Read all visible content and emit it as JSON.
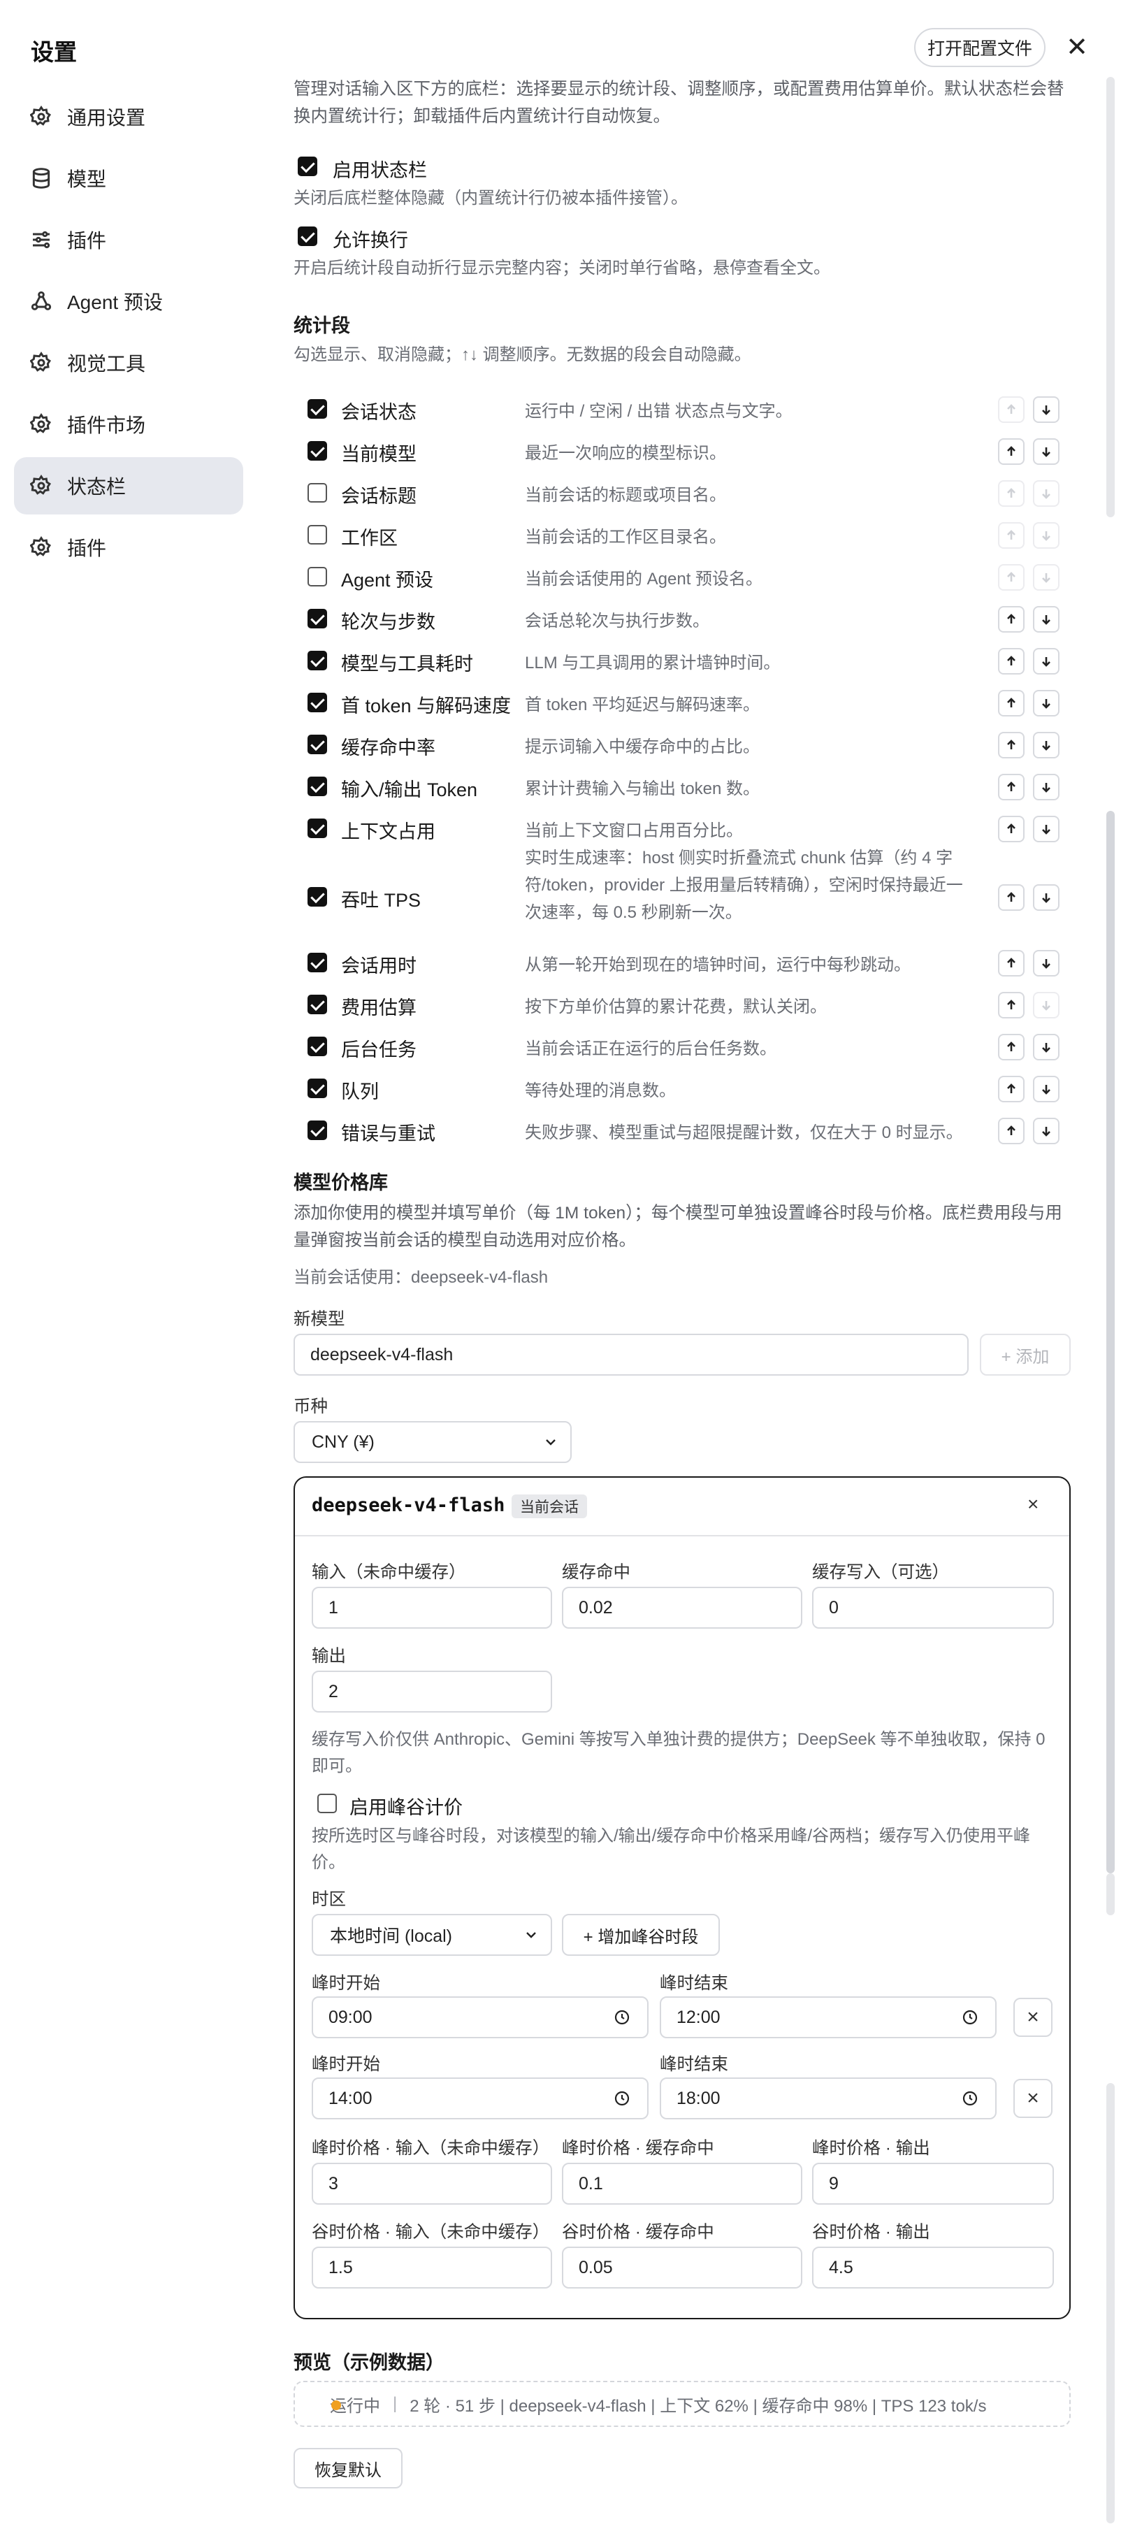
{
  "app": {
    "title": "设置",
    "open_config": "打开配置文件",
    "close": "✕"
  },
  "sidebar": {
    "items": [
      {
        "label": "通用设置",
        "icon": "gear-icon"
      },
      {
        "label": "模型",
        "icon": "database-icon"
      },
      {
        "label": "插件",
        "icon": "sliders-icon"
      },
      {
        "label": "Agent 预设",
        "icon": "agent-icon"
      },
      {
        "label": "视觉工具",
        "icon": "gear-icon"
      },
      {
        "label": "插件市场",
        "icon": "gear-icon"
      },
      {
        "label": "状态栏",
        "icon": "gear-icon",
        "active": true
      },
      {
        "label": "插件",
        "icon": "gear-icon"
      }
    ]
  },
  "statusbar": {
    "intro": "管理对话输入区下方的底栏：选择要显示的统计段、调整顺序，或配置费用估算单价。默认状态栏会替换内置统计行；卸载插件后内置统计行自动恢复。",
    "enable": {
      "label": "启用状态栏",
      "checked": true,
      "hint": "关闭后底栏整体隐藏（内置统计行仍被本插件接管）。"
    },
    "wrap": {
      "label": "允许换行",
      "checked": true,
      "hint": "开启后统计段自动折行显示完整内容；关闭时单行省略，悬停查看全文。"
    }
  },
  "segments": {
    "title": "统计段",
    "hint": "勾选显示、取消隐藏；↑↓ 调整顺序。无数据的段会自动隐藏。",
    "rows": [
      {
        "label": "会话状态",
        "desc": "运行中 / 空闲 / 出错 状态点与文字。",
        "checked": true,
        "up": false,
        "down": true
      },
      {
        "label": "当前模型",
        "desc": "最近一次响应的模型标识。",
        "checked": true,
        "up": true,
        "down": true
      },
      {
        "label": "会话标题",
        "desc": "当前会话的标题或项目名。",
        "checked": false,
        "up": false,
        "down": false
      },
      {
        "label": "工作区",
        "desc": "当前会话的工作区目录名。",
        "checked": false,
        "up": false,
        "down": false
      },
      {
        "label": "Agent 预设",
        "desc": "当前会话使用的 Agent 预设名。",
        "checked": false,
        "up": false,
        "down": false
      },
      {
        "label": "轮次与步数",
        "desc": "会话总轮次与执行步数。",
        "checked": true,
        "up": true,
        "down": true
      },
      {
        "label": "模型与工具耗时",
        "desc": "LLM 与工具调用的累计墙钟时间。",
        "checked": true,
        "up": true,
        "down": true
      },
      {
        "label": "首 token 与解码速度",
        "desc": "首 token 平均延迟与解码速率。",
        "checked": true,
        "up": true,
        "down": true
      },
      {
        "label": "缓存命中率",
        "desc": "提示词输入中缓存命中的占比。",
        "checked": true,
        "up": true,
        "down": true
      },
      {
        "label": "输入/输出 Token",
        "desc": "累计计费输入与输出 token 数。",
        "checked": true,
        "up": true,
        "down": true
      },
      {
        "label": "上下文占用",
        "desc": "当前上下文窗口占用百分比。",
        "checked": true,
        "up": true,
        "down": true
      },
      {
        "label": "吞吐 TPS",
        "desc": "实时生成速率：host 侧实时折叠流式 chunk 估算（约 4 字符/token，provider 上报用量后转精确），空闲时保持最近一次速率，每 0.5 秒刷新一次。",
        "checked": true,
        "up": true,
        "down": true
      },
      {
        "label": "会话用时",
        "desc": "从第一轮开始到现在的墙钟时间，运行中每秒跳动。",
        "checked": true,
        "up": true,
        "down": true
      },
      {
        "label": "费用估算",
        "desc": "按下方单价估算的累计花费，默认关闭。",
        "checked": true,
        "up": true,
        "down": false
      },
      {
        "label": "后台任务",
        "desc": "当前会话正在运行的后台任务数。",
        "checked": true,
        "up": true,
        "down": true
      },
      {
        "label": "队列",
        "desc": "等待处理的消息数。",
        "checked": true,
        "up": true,
        "down": true
      },
      {
        "label": "错误与重试",
        "desc": "失败步骤、模型重试与超限提醒计数，仅在大于 0 时显示。",
        "checked": true,
        "up": true,
        "down": true
      }
    ]
  },
  "pricing": {
    "title": "模型价格库",
    "hint": "添加你使用的模型并填写单价（每 1M token）；每个模型可单独设置峰谷时段与价格。底栏费用段与用量弹窗按当前会话的模型自动选用对应价格。",
    "current": "当前会话使用：deepseek-v4-flash",
    "new_model_label": "新模型",
    "new_model_value": "deepseek-v4-flash",
    "add_btn": "+ 添加",
    "currency_label": "币种",
    "currency_value": "CNY (¥)",
    "card": {
      "model": "deepseek-v4-flash",
      "badge": "当前会话",
      "remove": "×",
      "input_label": "输入（未命中缓存）",
      "input_value": "1",
      "cache_hit_label": "缓存命中",
      "cache_hit_value": "0.02",
      "cache_write_label": "缓存写入（可选）",
      "cache_write_value": "0",
      "output_label": "输出",
      "output_value": "2",
      "cache_note": "缓存写入价仅供 Anthropic、Gemini 等按写入单独计费的提供方；DeepSeek 等不单独收取，保持 0 即可。",
      "peak_enable_label": "启用峰谷计价",
      "peak_enabled": false,
      "peak_note": "按所选时区与峰谷时段，对该模型的输入/输出/缓存命中价格采用峰/谷两档；缓存写入仍使用平峰价。",
      "tz_label": "时区",
      "tz_value": "本地时间 (local)",
      "add_period": "+ 增加峰谷时段",
      "periods": [
        {
          "start_label": "峰时开始",
          "start": "09:00",
          "end_label": "峰时结束",
          "end": "12:00"
        },
        {
          "start_label": "峰时开始",
          "start": "14:00",
          "end_label": "峰时结束",
          "end": "18:00"
        }
      ],
      "peak_input_label": "峰时价格 · 输入（未命中缓存）",
      "peak_input": "3",
      "peak_cache_label": "峰时价格 · 缓存命中",
      "peak_cache": "0.1",
      "peak_output_label": "峰时价格 · 输出",
      "peak_output": "9",
      "off_input_label": "谷时价格 · 输入（未命中缓存）",
      "off_input": "1.5",
      "off_cache_label": "谷时价格 · 缓存命中",
      "off_cache": "0.05",
      "off_output_label": "谷时价格 · 输出",
      "off_output": "4.5"
    }
  },
  "preview": {
    "title": "预览（示例数据）",
    "status": "运行中",
    "sep": "|",
    "text": "2 轮 · 51 步 | deepseek-v4-flash | 上下文 62% | 缓存命中 98% | TPS 123 tok/s",
    "status_color": "#f0a020"
  },
  "reset": "恢复默认"
}
